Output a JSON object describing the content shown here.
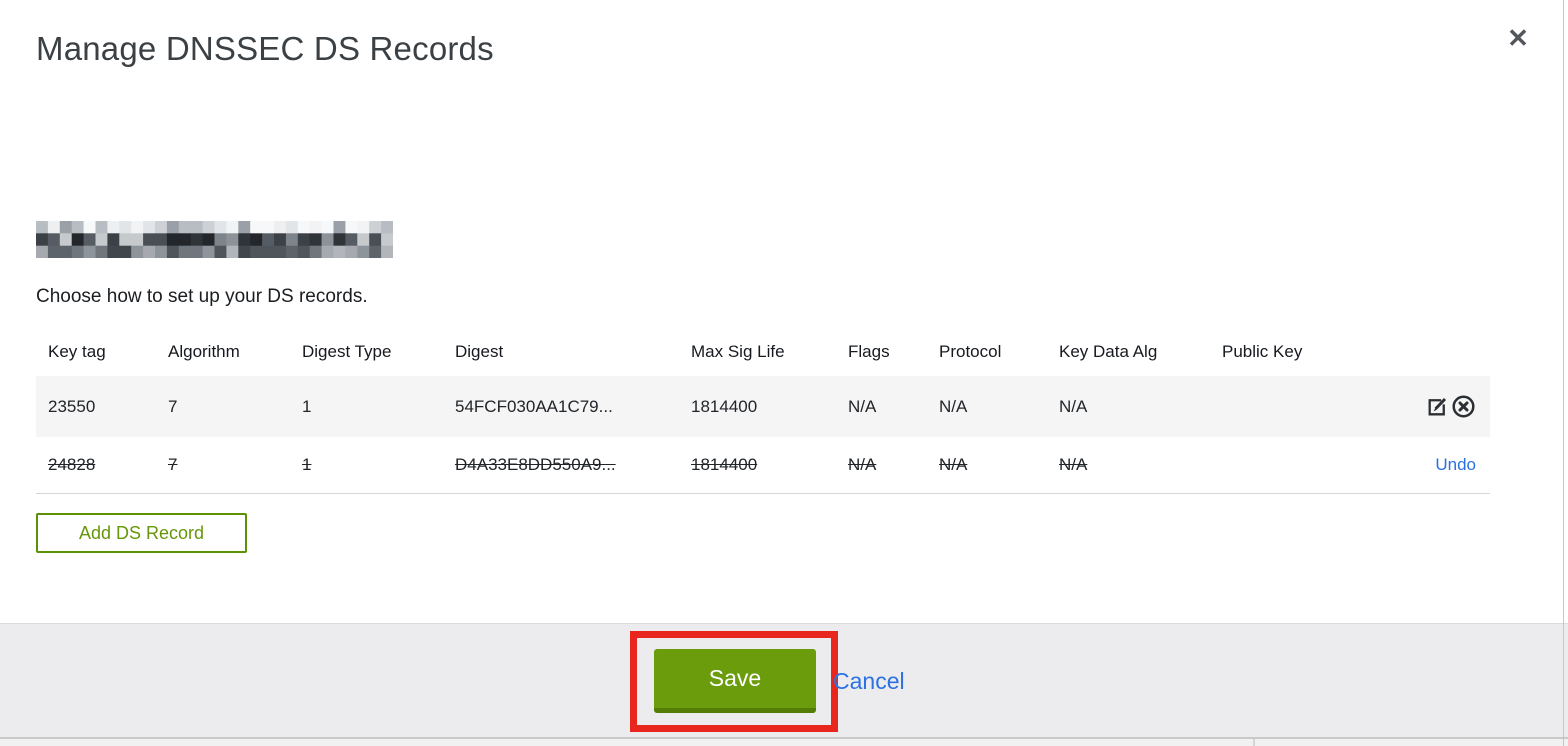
{
  "modal": {
    "title": "Manage DNSSEC DS Records",
    "domain_redacted": true,
    "instruction": "Choose how to set up your DS records.",
    "table": {
      "columns": [
        "Key tag",
        "Algorithm",
        "Digest Type",
        "Digest",
        "Max Sig Life",
        "Flags",
        "Protocol",
        "Key Data Alg",
        "Public Key"
      ],
      "rows": [
        {
          "key_tag": "23550",
          "algorithm": "7",
          "digest_type": "1",
          "digest": "54FCF030AA1C79...",
          "max_sig_life": "1814400",
          "flags": "N/A",
          "protocol": "N/A",
          "key_data_alg": "N/A",
          "public_key": "",
          "state": "current",
          "actions": [
            "edit",
            "delete"
          ]
        },
        {
          "key_tag": "24828",
          "algorithm": "7",
          "digest_type": "1",
          "digest": "D4A33E8DD550A9...",
          "max_sig_life": "1814400",
          "flags": "N/A",
          "protocol": "N/A",
          "key_data_alg": "N/A",
          "public_key": "",
          "state": "deleted",
          "actions": [
            "undo"
          ],
          "undo_label": "Undo"
        }
      ]
    },
    "add_button_label": "Add DS Record",
    "footer": {
      "save_label": "Save",
      "cancel_label": "Cancel"
    },
    "close_glyph": "✕"
  },
  "icons": {
    "close": "x-glyph",
    "edit": "pencil-on-square",
    "delete": "x-in-circle"
  },
  "colors": {
    "save_green": "#6b9c0b",
    "save_green_dark": "#547d08",
    "outline_green": "#5d9104",
    "green_text": "#669708",
    "link_blue": "#2a72e4",
    "annotation_red": "#e8261d",
    "row_highlight_bg": "#f5f5f5",
    "footer_bg": "#ececee",
    "title_gray": "#3b4045"
  }
}
